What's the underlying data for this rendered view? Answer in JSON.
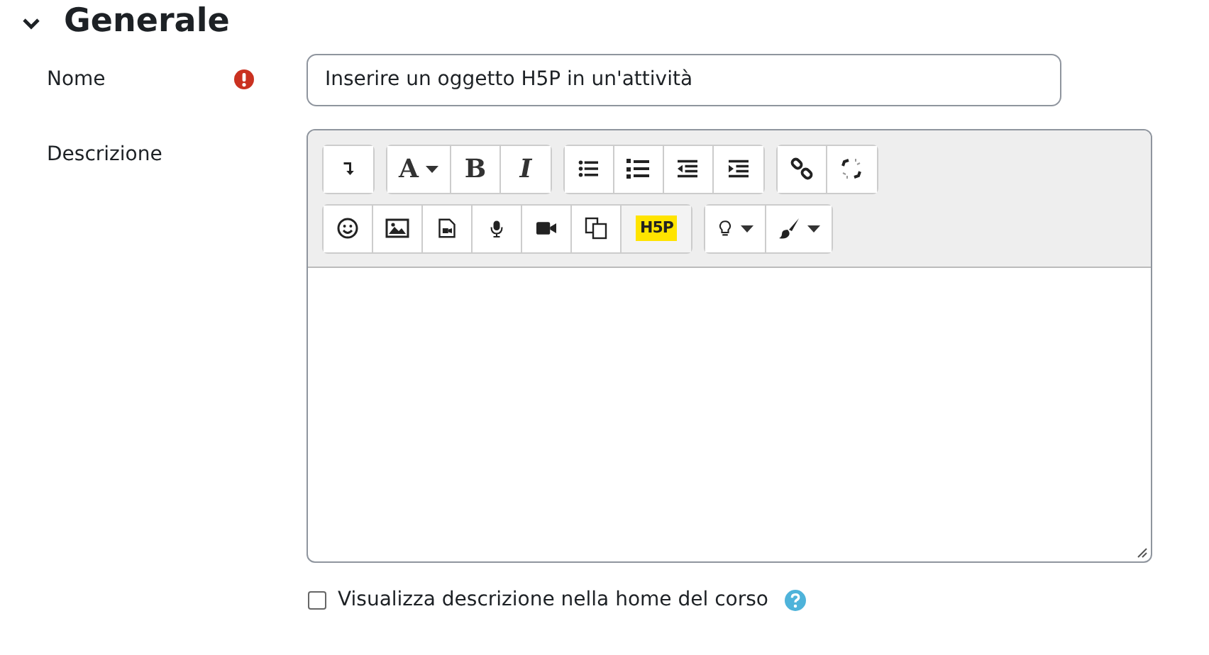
{
  "section": {
    "title": "Generale",
    "expanded": true
  },
  "name_field": {
    "label": "Nome",
    "required": true,
    "value": "Inserire un oggetto H5P in un'attività"
  },
  "description": {
    "label": "Descrizione",
    "toolbar_rows": [
      [
        [
          {
            "kind": "icon",
            "selected": false
          }
        ],
        [
          {
            "kind": "text",
            "label": "A",
            "caret": true,
            "selected": false
          },
          {
            "kind": "text",
            "label": "B",
            "caret": false,
            "selected": false
          },
          {
            "kind": "text",
            "label": "I",
            "caret": false,
            "selected": false
          }
        ],
        [
          {
            "kind": "icon",
            "selected": false
          },
          {
            "kind": "icon",
            "selected": false
          },
          {
            "kind": "icon",
            "selected": false
          },
          {
            "kind": "icon",
            "selected": false
          }
        ],
        [
          {
            "kind": "icon",
            "selected": false
          },
          {
            "kind": "icon",
            "selected": false
          }
        ]
      ],
      [
        [
          {
            "kind": "icon",
            "selected": false
          },
          {
            "kind": "icon",
            "selected": false
          },
          {
            "kind": "icon",
            "selected": false
          },
          {
            "kind": "icon",
            "selected": false
          },
          {
            "kind": "icon",
            "selected": false
          },
          {
            "kind": "icon",
            "selected": false
          },
          {
            "kind": "logo",
            "label": "H5P",
            "selected": true
          }
        ],
        [
          {
            "kind": "icon",
            "caret": true,
            "selected": false
          },
          {
            "kind": "icon",
            "caret": true,
            "selected": false
          }
        ]
      ]
    ]
  },
  "show_description": {
    "label": "Visualizza descrizione nella home del corso",
    "checked": false
  }
}
